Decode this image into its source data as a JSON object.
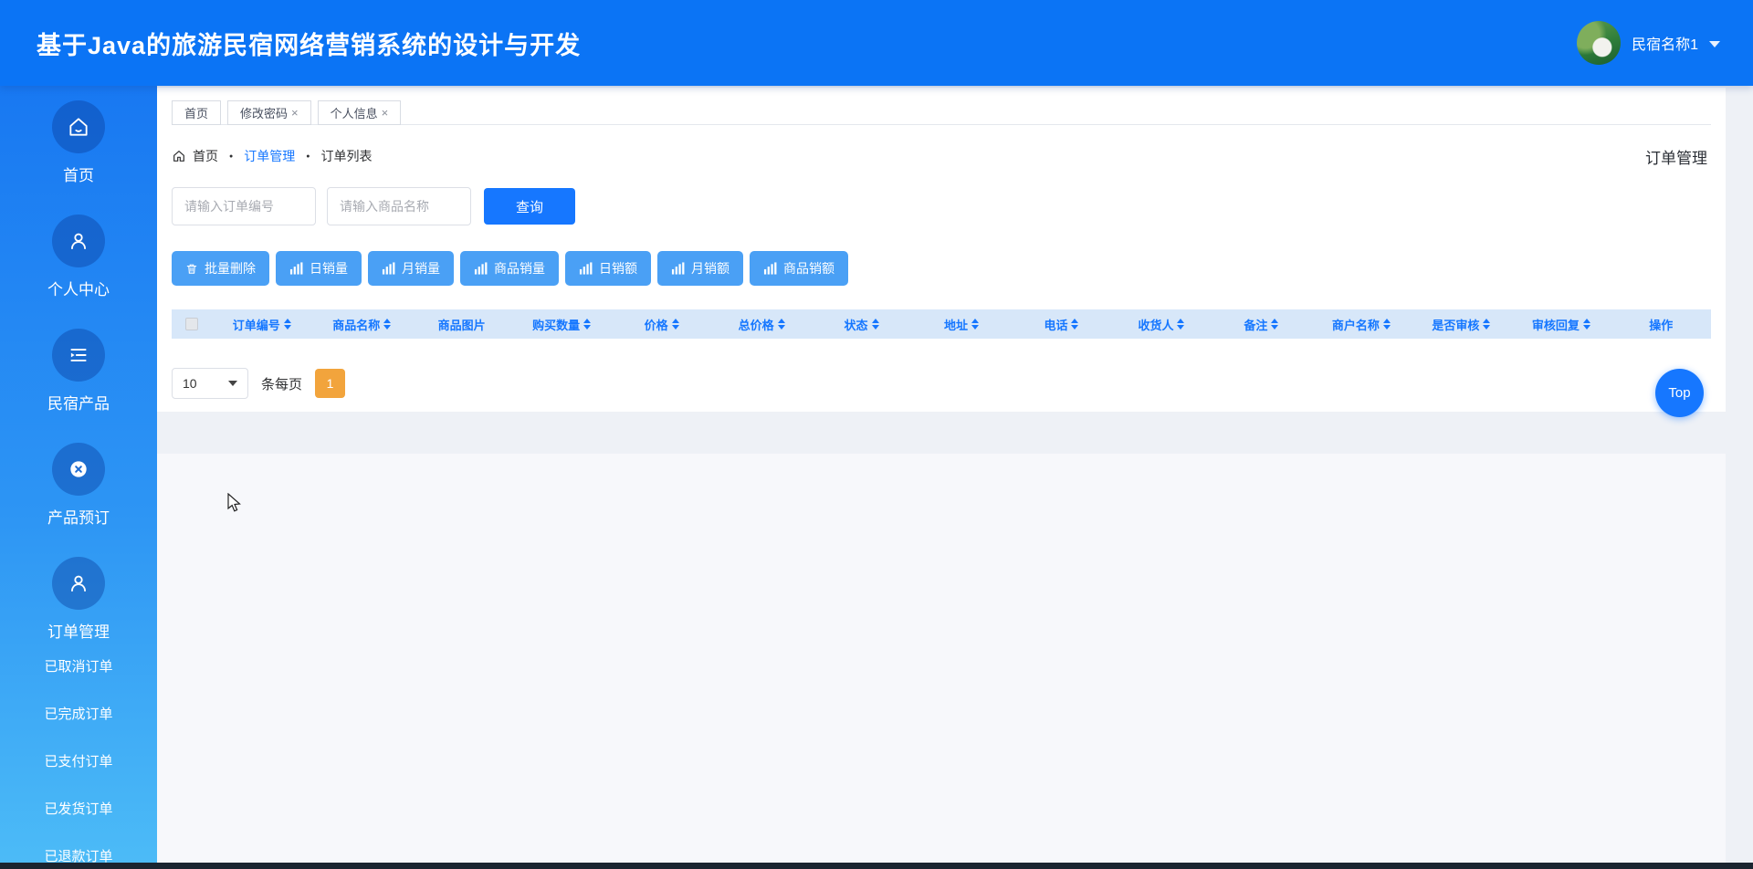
{
  "header": {
    "title": "基于Java的旅游民宿网络营销系统的设计与开发",
    "user_name": "民宿名称1"
  },
  "sidebar": {
    "items": [
      {
        "label": "首页",
        "icon": "home-icon"
      },
      {
        "label": "个人中心",
        "icon": "person-icon"
      },
      {
        "label": "民宿产品",
        "icon": "product-list-icon"
      },
      {
        "label": "产品预订",
        "icon": "booking-icon"
      },
      {
        "label": "订单管理",
        "icon": "orders-icon"
      }
    ],
    "subitems": [
      {
        "label": "已取消订单"
      },
      {
        "label": "已完成订单"
      },
      {
        "label": "已支付订单"
      },
      {
        "label": "已发货订单"
      },
      {
        "label": "已退款订单"
      }
    ]
  },
  "tabs": {
    "close_glyph": "×",
    "items": [
      {
        "label": "首页",
        "closable": false
      },
      {
        "label": "修改密码",
        "closable": true
      },
      {
        "label": "个人信息",
        "closable": true
      }
    ]
  },
  "breadcrumb": {
    "home": "首页",
    "separator": "●",
    "section": "订单管理",
    "page": "订单列表",
    "right_title": "订单管理"
  },
  "search": {
    "order_placeholder": "请输入订单编号",
    "product_placeholder": "请输入商品名称",
    "query_label": "查询"
  },
  "actions": [
    {
      "label": "批量删除",
      "icon": "trash-icon"
    },
    {
      "label": "日销量",
      "icon": "bar-chart-icon"
    },
    {
      "label": "月销量",
      "icon": "bar-chart-icon"
    },
    {
      "label": "商品销量",
      "icon": "bar-chart-icon"
    },
    {
      "label": "日销额",
      "icon": "bar-chart-icon"
    },
    {
      "label": "月销额",
      "icon": "bar-chart-icon"
    },
    {
      "label": "商品销额",
      "icon": "bar-chart-icon"
    }
  ],
  "table": {
    "columns": [
      {
        "label": "订单编号",
        "sortable": true
      },
      {
        "label": "商品名称",
        "sortable": true
      },
      {
        "label": "商品图片",
        "sortable": false
      },
      {
        "label": "购买数量",
        "sortable": true
      },
      {
        "label": "价格",
        "sortable": true
      },
      {
        "label": "总价格",
        "sortable": true
      },
      {
        "label": "状态",
        "sortable": true
      },
      {
        "label": "地址",
        "sortable": true
      },
      {
        "label": "电话",
        "sortable": true
      },
      {
        "label": "收货人",
        "sortable": true
      },
      {
        "label": "备注",
        "sortable": true
      },
      {
        "label": "商户名称",
        "sortable": true
      },
      {
        "label": "是否审核",
        "sortable": true
      },
      {
        "label": "审核回复",
        "sortable": true
      },
      {
        "label": "操作",
        "sortable": false
      }
    ],
    "rows": []
  },
  "pagination": {
    "page_size": "10",
    "per_page_label": "条每页",
    "page": "1"
  },
  "top_button_label": "Top",
  "colors": {
    "accent": "#1677ff",
    "header_blue": "#0b74f5",
    "sidebar_top": "#1878f2",
    "sidebar_bottom": "#4cbbf7",
    "table_header_bg": "#d7e7f9",
    "action_button_blue": "#4aa0f5",
    "active_page_orange": "#f2a43c",
    "footer_strip": "#1b2530"
  }
}
